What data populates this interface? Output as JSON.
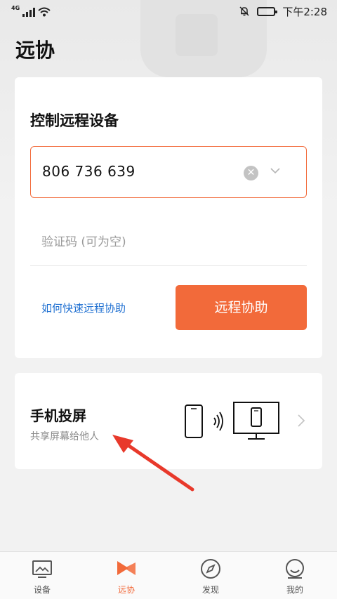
{
  "status_bar": {
    "network": "4G",
    "time": "下午2:28"
  },
  "page_title": "远协",
  "remote_card": {
    "title": "控制远程设备",
    "device_id_value": "806 736 639",
    "code_placeholder": "验证码 (可为空)",
    "help_link": "如何快速远程协助",
    "assist_button": "远程协助"
  },
  "cast_card": {
    "title": "手机投屏",
    "subtitle": "共享屏幕给他人"
  },
  "tabs": [
    {
      "label": "设备",
      "icon": "monitor-image-icon",
      "active": false
    },
    {
      "label": "远协",
      "icon": "remote-assist-icon",
      "active": true
    },
    {
      "label": "发现",
      "icon": "compass-icon",
      "active": false
    },
    {
      "label": "我的",
      "icon": "user-icon",
      "active": false
    }
  ],
  "colors": {
    "accent": "#f26a3a",
    "link": "#1e6fd1",
    "annotation": "#e8392b"
  }
}
